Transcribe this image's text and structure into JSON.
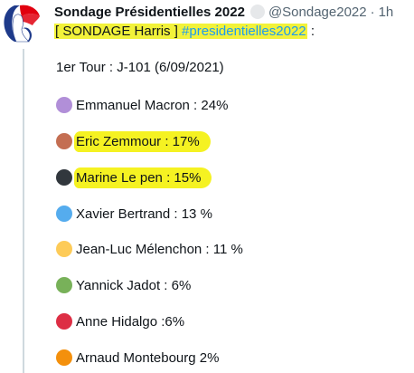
{
  "tweet": {
    "display_name": "Sondage Présidentielles 2022",
    "verified_icon": "badge-icon",
    "handle": "@Sondage2022",
    "separator": "·",
    "time": "1h",
    "open_bracket": "[",
    "sondage_label": "SONDAGE Harris",
    "close_bracket": "]",
    "hashtag": "#presidentielles2022",
    "trailing": ":",
    "round": "1er Tour : J-101 (6/09/2021)",
    "candidates": [
      {
        "label": "Emmanuel Macron : 24%",
        "color": "#b18fd8",
        "highlighted": false
      },
      {
        "label": "Eric Zemmour : 17%",
        "color": "#c46e52",
        "highlighted": true
      },
      {
        "label": "Marine Le pen : 15%",
        "color": "#31373d",
        "highlighted": true
      },
      {
        "label": "Xavier Bertrand : 13 %",
        "color": "#55acee",
        "highlighted": false
      },
      {
        "label": "Jean-Luc Mélenchon : 11 %",
        "color": "#fdcb58",
        "highlighted": false
      },
      {
        "label": "Yannick Jadot : 6%",
        "color": "#78b159",
        "highlighted": false
      },
      {
        "label": "Anne Hidalgo :6%",
        "color": "#dd2e44",
        "highlighted": false
      },
      {
        "label": "Arnaud Montebourg 2%",
        "color": "#f4900c",
        "highlighted": false
      }
    ]
  }
}
